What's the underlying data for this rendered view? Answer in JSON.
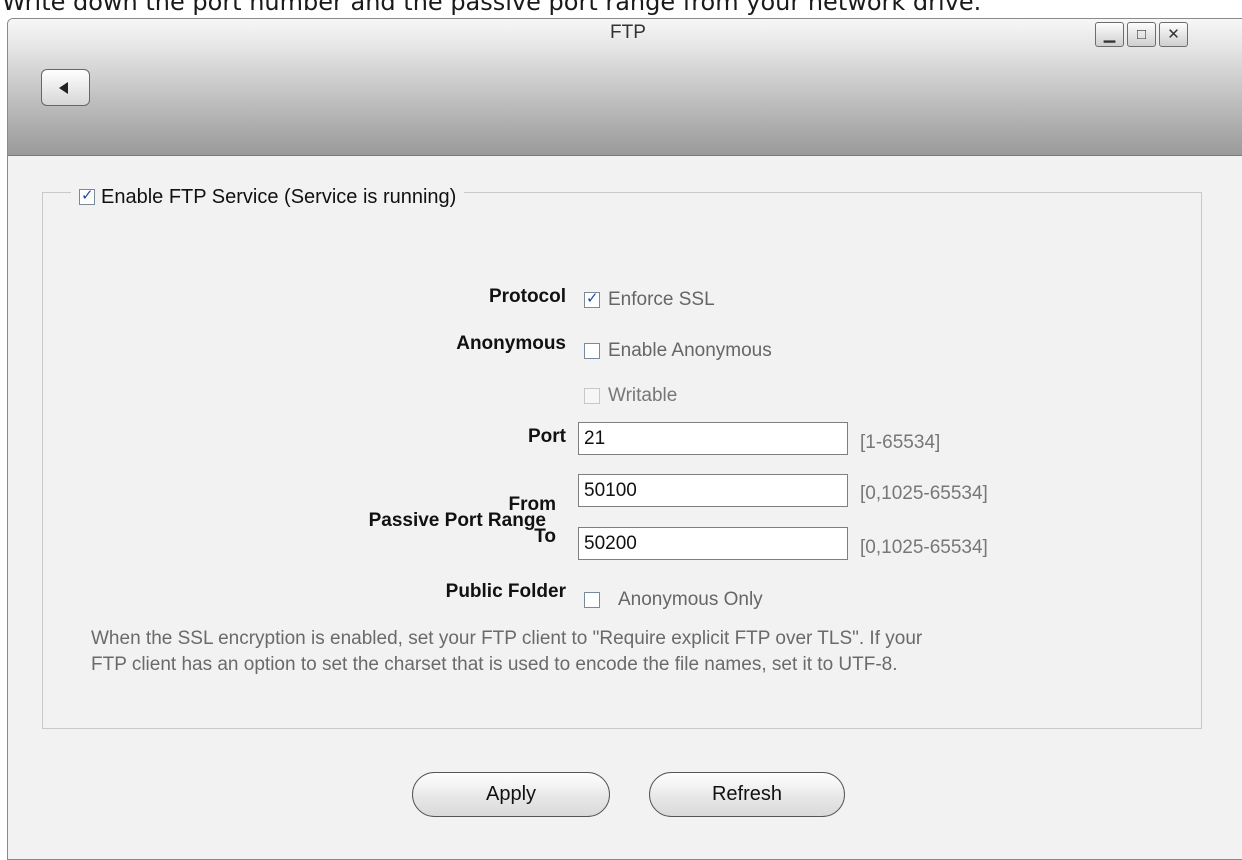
{
  "instruction": "Write down the port number and the passive port range from your network drive.",
  "window": {
    "title": "FTP",
    "minimize_icon": "minimize-icon",
    "maximize_icon": "maximize-icon",
    "close_icon": "close-icon",
    "back_icon": "back-arrow-icon"
  },
  "service": {
    "enable_label": "Enable FTP Service (Service is running)",
    "enabled": true
  },
  "form": {
    "protocol_label": "Protocol",
    "enforce_ssl_label": "Enforce SSL",
    "enforce_ssl_checked": true,
    "anonymous_label": "Anonymous",
    "enable_anonymous_label": "Enable Anonymous",
    "enable_anonymous_checked": false,
    "writable_label": "Writable",
    "writable_checked": false,
    "port_label": "Port",
    "port_value": "21",
    "port_range": "[1-65534]",
    "passive_label": "Passive Port Range",
    "from_label": "From",
    "from_value": "50100",
    "from_range": "[0,1025-65534]",
    "to_label": "To",
    "to_value": "50200",
    "to_range": "[0,1025-65534]",
    "public_folder_label": "Public Folder",
    "anonymous_only_label": "Anonymous Only",
    "anonymous_only_checked": false
  },
  "note_line1": "When the SSL encryption is enabled, set your FTP client to \"Require explicit FTP over TLS\". If your",
  "note_line2": "FTP client has an option to set the charset that is used to encode the file names, set it to UTF-8.",
  "buttons": {
    "apply": "Apply",
    "refresh": "Refresh"
  }
}
